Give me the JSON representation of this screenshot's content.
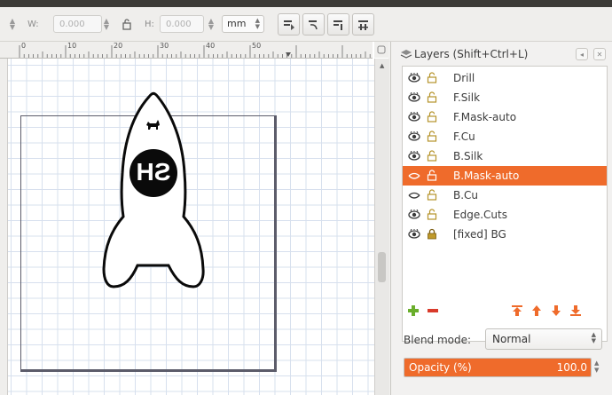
{
  "toolbar": {
    "w_label": "W:",
    "w_value": "0.000",
    "h_label": "H:",
    "h_value": "0.000",
    "unit": "mm"
  },
  "ruler": {
    "labels": [
      "0",
      "10",
      "20",
      "30",
      "40",
      "50"
    ]
  },
  "design": {
    "text": "SH"
  },
  "layers_panel": {
    "title": "Layers (Shift+Ctrl+L)",
    "layers": [
      {
        "name": "Drill",
        "visible": true,
        "locked": false,
        "selected": false
      },
      {
        "name": "F.Silk",
        "visible": true,
        "locked": false,
        "selected": false
      },
      {
        "name": "F.Mask-auto",
        "visible": true,
        "locked": false,
        "selected": false
      },
      {
        "name": "F.Cu",
        "visible": true,
        "locked": false,
        "selected": false
      },
      {
        "name": "B.Silk",
        "visible": true,
        "locked": false,
        "selected": false
      },
      {
        "name": "B.Mask-auto",
        "visible": false,
        "locked": false,
        "selected": true
      },
      {
        "name": "B.Cu",
        "visible": false,
        "locked": false,
        "selected": false
      },
      {
        "name": "Edge.Cuts",
        "visible": true,
        "locked": false,
        "selected": false
      },
      {
        "name": "[fixed] BG",
        "visible": true,
        "locked": true,
        "selected": false
      }
    ],
    "blend_label": "Blend mode:",
    "blend_value": "Normal",
    "opacity_label": "Opacity (%)",
    "opacity_value": "100.0",
    "opacity_fraction": 1.0,
    "accent_color": "#ef6b2b",
    "icons": {
      "add": "plus-icon",
      "remove": "minus-icon",
      "move_top": "arrow-top-icon",
      "move_up": "arrow-up-icon",
      "move_down": "arrow-down-icon",
      "move_bottom": "arrow-bottom-icon"
    }
  }
}
